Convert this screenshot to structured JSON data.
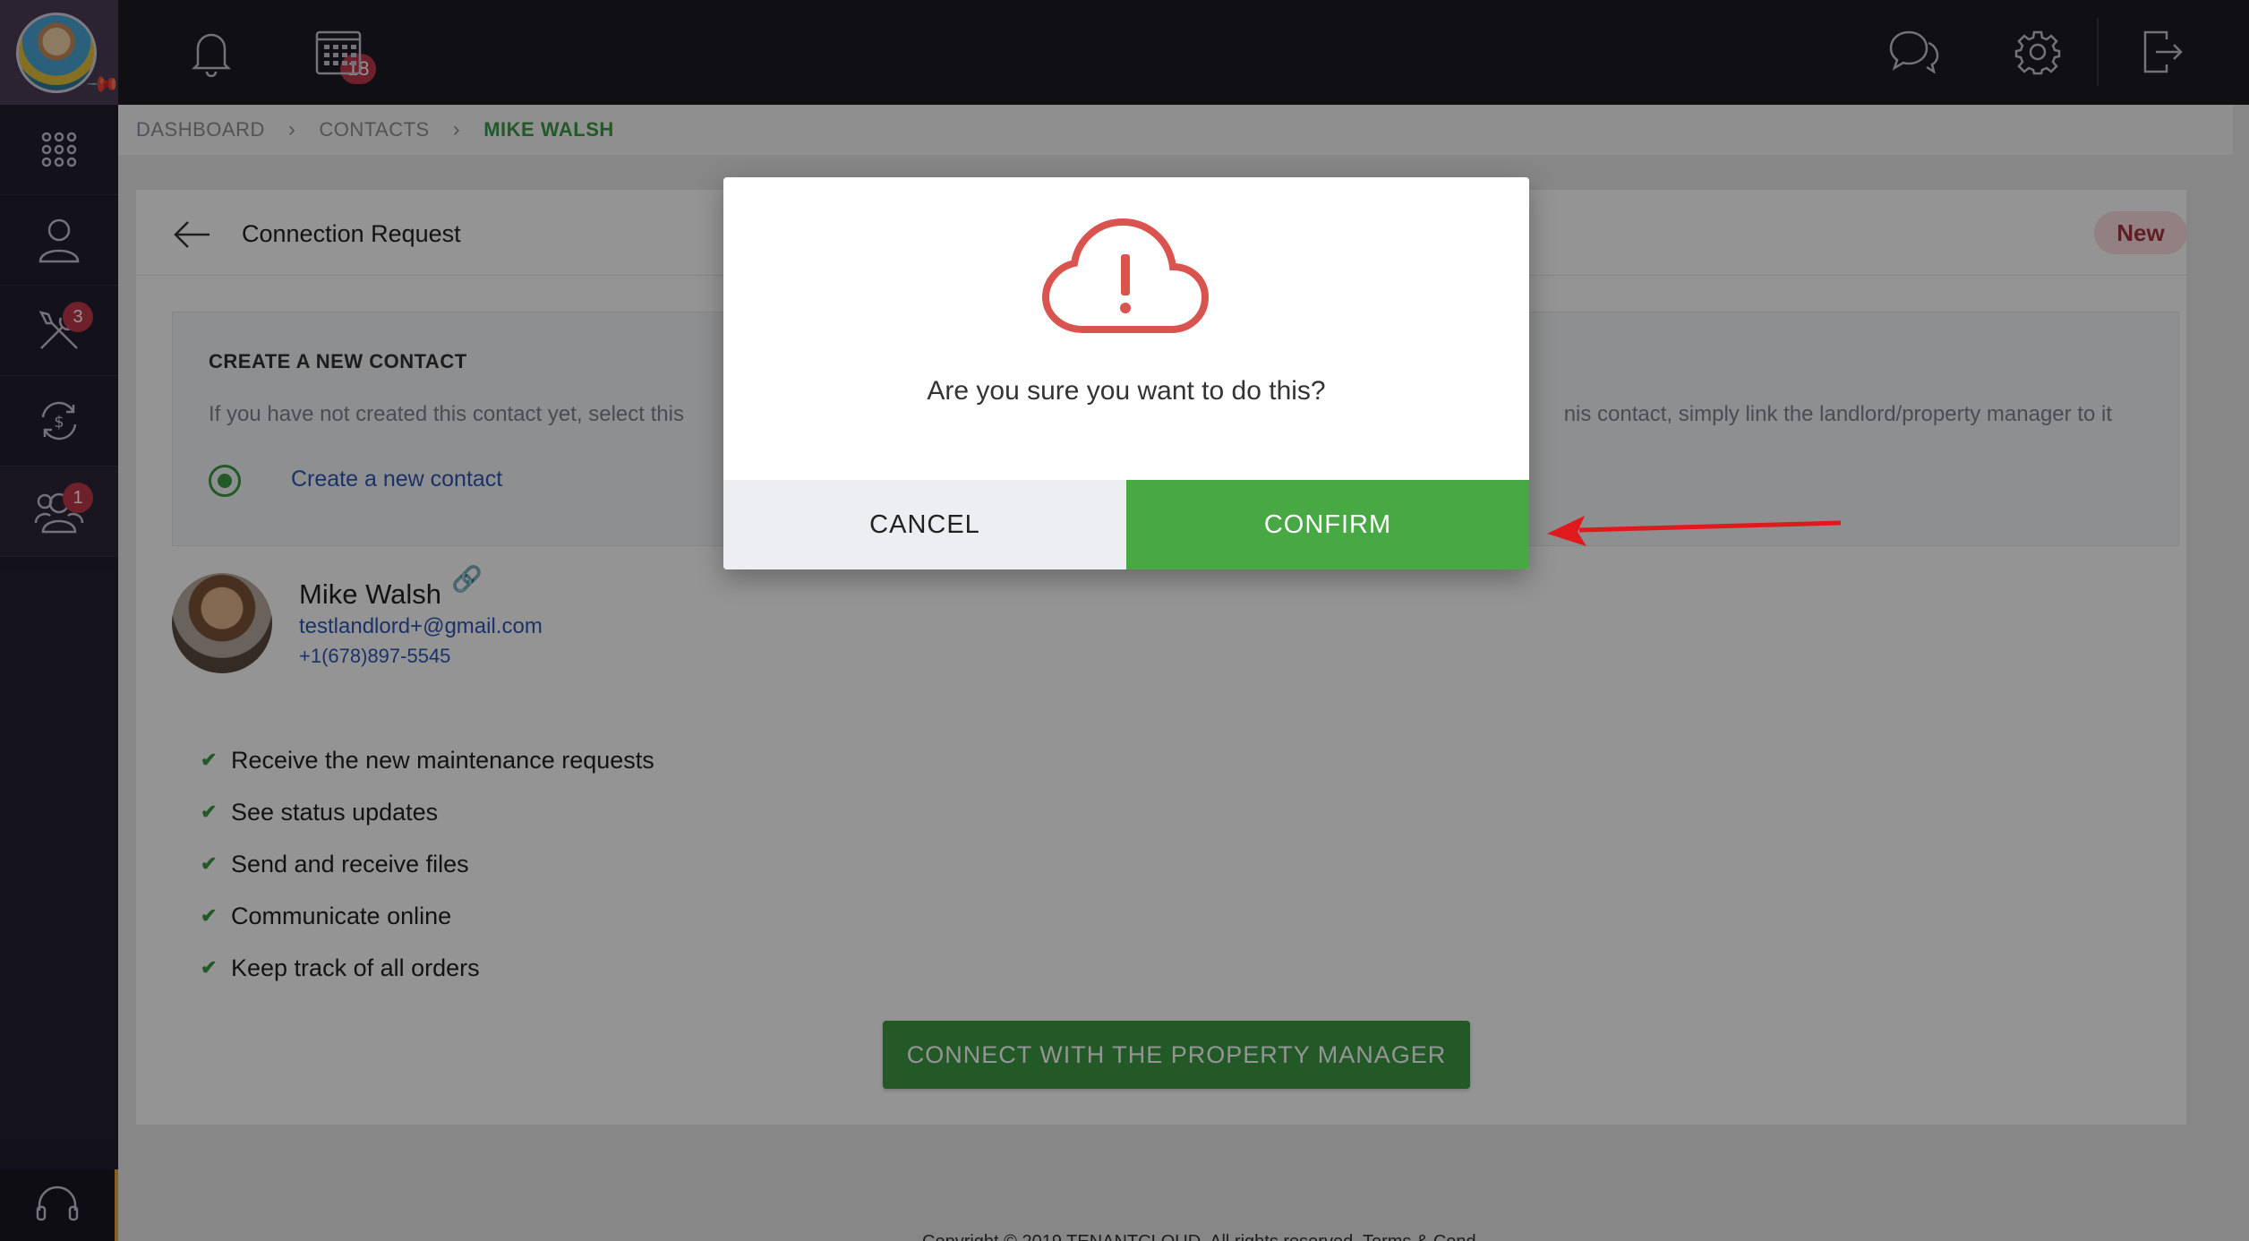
{
  "topbar": {
    "notification_count": "18"
  },
  "sidebar": {
    "badges": {
      "maintenance": "3",
      "contacts": "1"
    }
  },
  "breadcrumb": {
    "items": [
      "DASHBOARD",
      "CONTACTS",
      "MIKE WALSH"
    ]
  },
  "card": {
    "title": "Connection Request",
    "status_badge": "New",
    "create_section": {
      "title": "CREATE A NEW CONTACT",
      "description_left": "If you have not created this contact yet, select this",
      "description_right": "nis contact, simply link the landlord/property manager to it",
      "option_label": "Create a new contact"
    },
    "contact": {
      "name": "Mike Walsh",
      "email": "testlandlord+@gmail.com",
      "phone": "+1(678)897-5545"
    },
    "features": [
      "Receive the new maintenance requests",
      "See status updates",
      "Send and receive files",
      "Communicate online",
      "Keep track of all orders"
    ],
    "connect_button": "CONNECT WITH THE PROPERTY MANAGER"
  },
  "footer": {
    "text": "Copyright © 2019 TENANTCLOUD. All rights reserved. Terms & Cond"
  },
  "modal": {
    "message": "Are you sure you want to do this?",
    "cancel_label": "CANCEL",
    "confirm_label": "CONFIRM"
  },
  "colors": {
    "accent_green": "#47a844",
    "badge_red": "#c0394b",
    "link_blue": "#2f57b6",
    "alert_red": "#d9534f"
  }
}
